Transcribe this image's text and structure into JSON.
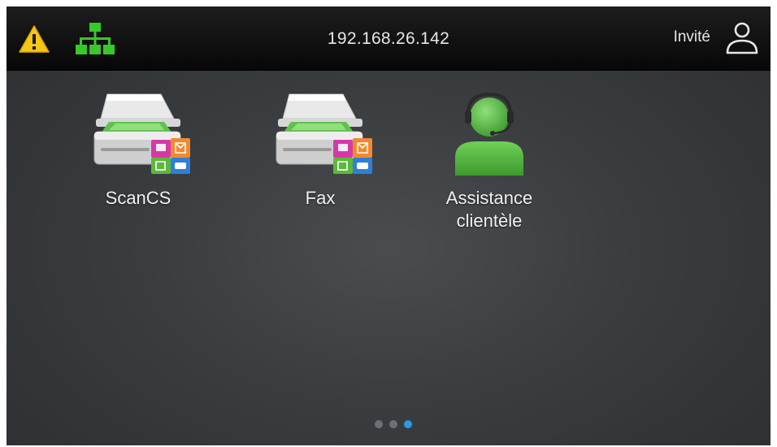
{
  "status_bar": {
    "ip_address": "192.168.26.142",
    "user_label": "Invité",
    "warning_icon": "warning-triangle-icon",
    "network_icon": "network-icon",
    "user_icon": "user-icon",
    "warning_color": "#f5c518",
    "network_color": "#37c82a"
  },
  "apps": [
    {
      "label": "ScanCS",
      "icon": "scanner-icon"
    },
    {
      "label": "Fax",
      "icon": "scanner-icon"
    },
    {
      "label": "Assistance\nclientèle",
      "icon": "customer-support-icon"
    }
  ],
  "pagination": {
    "pages": 3,
    "current_page": 3
  }
}
